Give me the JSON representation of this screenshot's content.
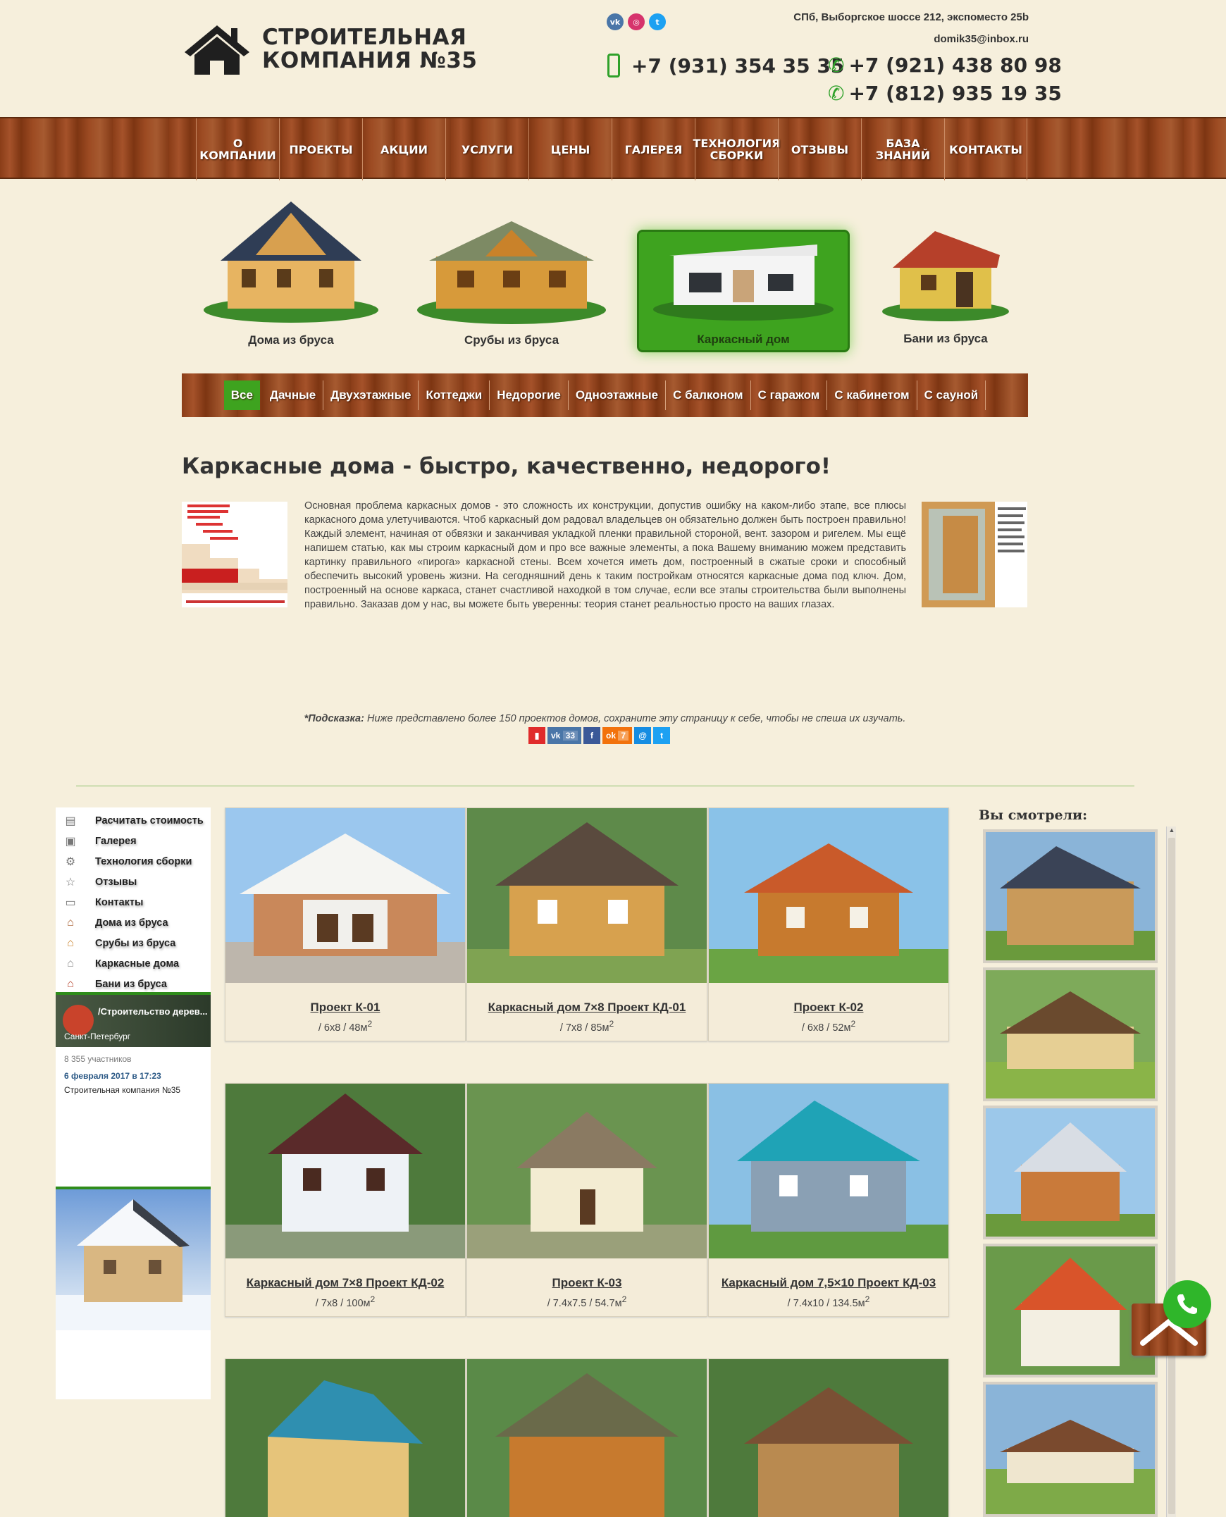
{
  "header": {
    "logo_line1": "СТРОИТЕЛЬНАЯ",
    "logo_line2": "КОМПАНИЯ №35",
    "address": "СПб, Выборгское шоссе 212, экспоместо 25b",
    "email": "domik35@inbox.ru",
    "phone_mobile": "+7 (931) 354 35 35",
    "phone_2": "+7 (921) 438 80 98",
    "phone_3": "+7 (812) 935 19 35",
    "socials": [
      "vk-icon",
      "instagram-icon",
      "twitter-icon"
    ]
  },
  "nav": {
    "items": [
      "О КОМПАНИИ",
      "ПРОЕКТЫ",
      "АКЦИИ",
      "УСЛУГИ",
      "ЦЕНЫ",
      "ГАЛЕРЕЯ",
      "ТЕХНОЛОГИЯ СБОРКИ",
      "ОТЗЫВЫ",
      "БАЗА ЗНАНИЙ",
      "КОНТАКТЫ"
    ]
  },
  "categories": {
    "items": [
      "Дома из бруса",
      "Срубы из бруса",
      "Каркасный дом",
      "Бани из бруса"
    ],
    "active": "Каркасный дом"
  },
  "filter": {
    "items": [
      "Все",
      "Дачные",
      "Двухэтажные",
      "Коттеджи",
      "Недорогие",
      "Одноэтажные",
      "С балконом",
      "С гаражом",
      "С кабинетом",
      "С сауной"
    ],
    "active": "Все"
  },
  "article": {
    "title": "Каркасные дома - быстро, качественно, недорого!",
    "text": "Основная проблема каркасных домов - это сложность их конструкции, допустив ошибку на каком-либо этапе, все плюсы каркасного дома улетучиваются. Чтоб каркасный дом радовал владельцев он обязательно должен быть построен правильно! Каждый элемент, начиная от обвязки и заканчивая укладкой пленки правильной стороной, вент. зазором и ригелем. Мы ещё напишем статью, как мы строим каркасный дом и про все важные элементы, а пока Вашему вниманию можем представить картинку правильного «пирога» каркасной стены. Всем хочется иметь дом, построенный в сжатые сроки и способный обеспечить высокий уровень жизни. На сегодняшний день к таким постройкам относятся каркасные дома под ключ. Дом, построенный на основе каркаса, станет счастливой находкой в том случае, если все этапы строительства были выполнены правильно. Заказав дом у нас, вы можете быть уверенны: теория станет реальностью просто на ваших глазах.",
    "hint_label": "*Подсказка:",
    "hint_text": " Ниже представлено более 150 проектов домов, сохраните эту страницу к себе, чтобы не спеша их изучать.",
    "share_vk_count": "33",
    "share_ok_count": "7"
  },
  "sidebar": {
    "menu": [
      "Расчитать стоимость",
      "Галерея",
      "Технология сборки",
      "Отзывы",
      "Контакты",
      "Дома из бруса",
      "Срубы из бруса",
      "Каркасные дома",
      "Бани из бруса"
    ],
    "vk_name": "/Строительство дерев...",
    "vk_city": "Санкт-Петербург",
    "vk_members": "8 355 участников",
    "vk_date": "6 февраля 2017 в 17:23",
    "vk_post": "Строительная компания №35"
  },
  "projects": [
    {
      "title": "Проект К-01",
      "size": "/ 6х8 / 48м",
      "sup": "2"
    },
    {
      "title": "Каркасный дом 7×8 Проект КД-01",
      "size": "/ 7х8 / 85м",
      "sup": "2"
    },
    {
      "title": "Проект К-02",
      "size": "/ 6х8 / 52м",
      "sup": "2"
    },
    {
      "title": "Каркасный дом 7×8 Проект КД-02",
      "size": "/ 7х8 / 100м",
      "sup": "2"
    },
    {
      "title": "Проект К-03",
      "size": "/ 7.4х7.5 / 54.7м",
      "sup": "2"
    },
    {
      "title": "Каркасный дом 7,5×10 Проект КД-03",
      "size": "/ 7.4х10 / 134.5м",
      "sup": "2"
    }
  ],
  "viewed": {
    "title": "Вы смотрели:"
  },
  "colors": {
    "background": "#f6efdc",
    "accent_green": "#3ea31f",
    "wood": "#8a3d18"
  }
}
